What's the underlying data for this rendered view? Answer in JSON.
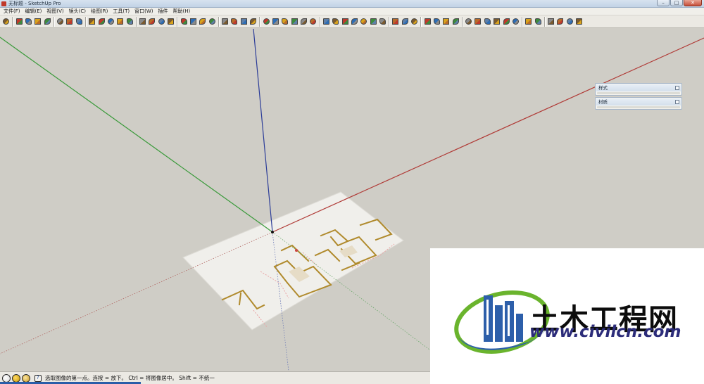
{
  "window": {
    "title": "无标题 - SketchUp Pro",
    "minimize_glyph": "–",
    "maximize_glyph": "□",
    "close_glyph": "✕"
  },
  "menu": [
    "文件(F)",
    "编辑(E)",
    "视图(V)",
    "镜头(C)",
    "绘图(R)",
    "工具(T)",
    "窗口(W)",
    "插件",
    "帮助(H)"
  ],
  "toolbar_icons": [
    "select-arrow-icon",
    "|",
    "pencil-line-icon",
    "rectangle-icon",
    "circle-icon",
    "arc-icon",
    "|",
    "make-component-icon",
    "eraser-icon",
    "paint-bucket-icon",
    "|",
    "push-pull-icon",
    "follow-me-icon",
    "move-icon",
    "rotate-icon",
    "offset-icon",
    "|",
    "orbit-icon",
    "pan-icon",
    "zoom-icon",
    "zoom-extents-icon",
    "|",
    "iso-view-icon",
    "section-plane-icon",
    "tape-measure-icon",
    "axes-icon",
    "|",
    "top-view-icon",
    "front-view-icon",
    "right-view-icon",
    "back-view-icon",
    "|",
    "xray-icon",
    "wireframe-icon",
    "hidden-line-icon",
    "shaded-icon",
    "textured-icon",
    "monochrome-icon",
    "|",
    "sandbox-from-contours-icon",
    "sandbox-from-scratch-icon",
    "smoove-icon",
    "stamp-icon",
    "drape-icon",
    "add-detail-icon",
    "flip-edge-icon",
    "|",
    "walk-icon",
    "look-around-icon",
    "position-camera-icon",
    "|",
    "dimension-icon",
    "protractor-icon",
    "text-icon",
    "3d-text-icon",
    "|",
    "get-models-icon",
    "share-model-icon",
    "share-component-icon",
    "google-earth-icon",
    "toggle-terrain-icon",
    "add-location-icon",
    "|",
    "solid-union-icon",
    "solid-subtract-icon",
    "|",
    "layer-manager-icon",
    "scene-icon",
    "styles-icon",
    "shadow-icon"
  ],
  "trays": [
    {
      "title": "样式"
    },
    {
      "title": "材质"
    }
  ],
  "status": {
    "text": "选取图像的第一点。连按 = 放下。 Ctrl = 将图像居中。 Shift = 不统一"
  },
  "watermark": {
    "name": "土木工程网",
    "url": "www.civilcn.com",
    "colors": {
      "blue": "#2d5faa",
      "green": "#6ab42d",
      "dark": "#0c0c0c"
    }
  },
  "axes_colors": {
    "red": "#b03a36",
    "green": "#3a9a3a",
    "blue": "#2b3c98"
  }
}
